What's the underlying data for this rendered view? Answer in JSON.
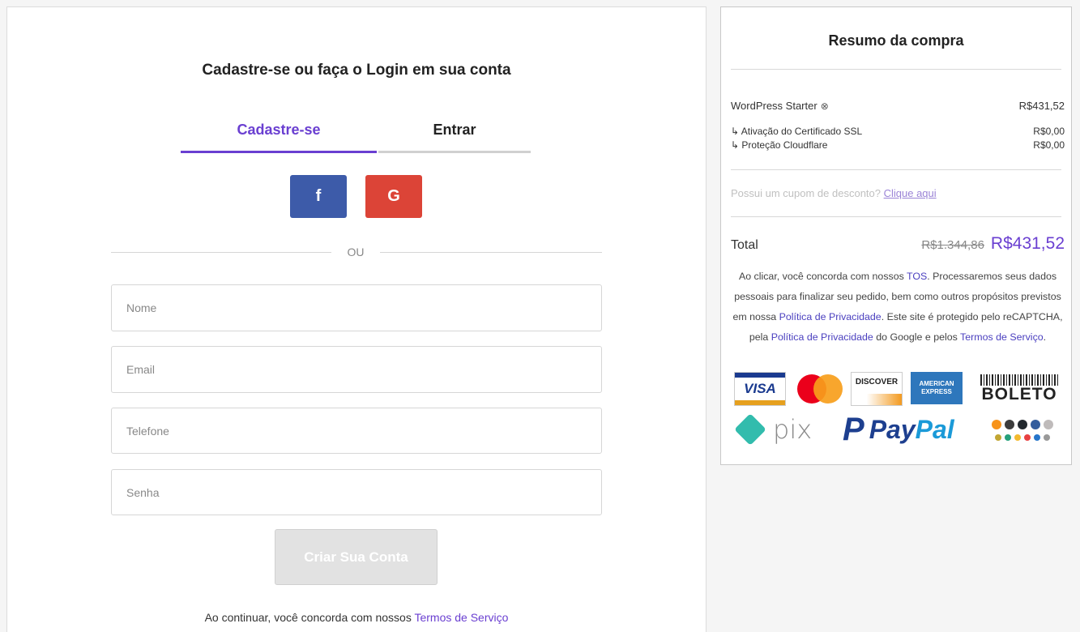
{
  "signup": {
    "heading": "Cadastre-se ou faça o Login em sua conta",
    "tabs": [
      {
        "label": "Cadastre-se",
        "active": true
      },
      {
        "label": "Entrar",
        "active": false
      }
    ],
    "social": {
      "facebook_glyph": "f",
      "google_glyph": "G",
      "facebook_color": "#3d5ba9",
      "google_color": "#dc4437"
    },
    "divider_text": "OU",
    "fields": {
      "name_placeholder": "Nome",
      "email_placeholder": "Email",
      "phone_placeholder": "Telefone",
      "password_placeholder": "Senha"
    },
    "submit_label": "Criar Sua Conta",
    "terms_prefix": "Ao continuar, você concorda com nossos ",
    "terms_link": "Termos de Serviço"
  },
  "summary": {
    "title": "Resumo da compra",
    "plan": {
      "name": "WordPress Starter",
      "remove_icon": "⊗",
      "price": "R$431,52"
    },
    "addons": [
      {
        "name": "↳ Ativação do Certificado SSL",
        "price": "R$0,00"
      },
      {
        "name": "↳ Proteção Cloudflare",
        "price": "R$0,00"
      }
    ],
    "coupon_text": "Possui um cupom de desconto? ",
    "coupon_link": "Clique aqui",
    "total_label": "Total",
    "old_price": "R$1.344,86",
    "new_price": "R$431,52",
    "legal": {
      "p1": "Ao clicar, você concorda com nossos ",
      "tos": "TOS",
      "p2": ". Processaremos seus dados pessoais para finalizar seu pedido, bem como outros propósitos previstos em nossa ",
      "privacy1": "Política de Privacidade",
      "p3": ". Este site é protegido pelo reCAPTCHA, pela ",
      "privacy2": "Política de Privacidade",
      "p4": " do Google e pelos ",
      "terms": "Termos de Serviço",
      "p5": "."
    },
    "payment_logos": {
      "visa": "VISA",
      "discover": "DISCOVER",
      "amex": "AMERICAN EXPRESS",
      "boleto": "BOLETO",
      "pix": "pix",
      "paypal_pay": "Pay",
      "paypal_pal": "Pal"
    },
    "accent_color": "#6a3fd1"
  }
}
